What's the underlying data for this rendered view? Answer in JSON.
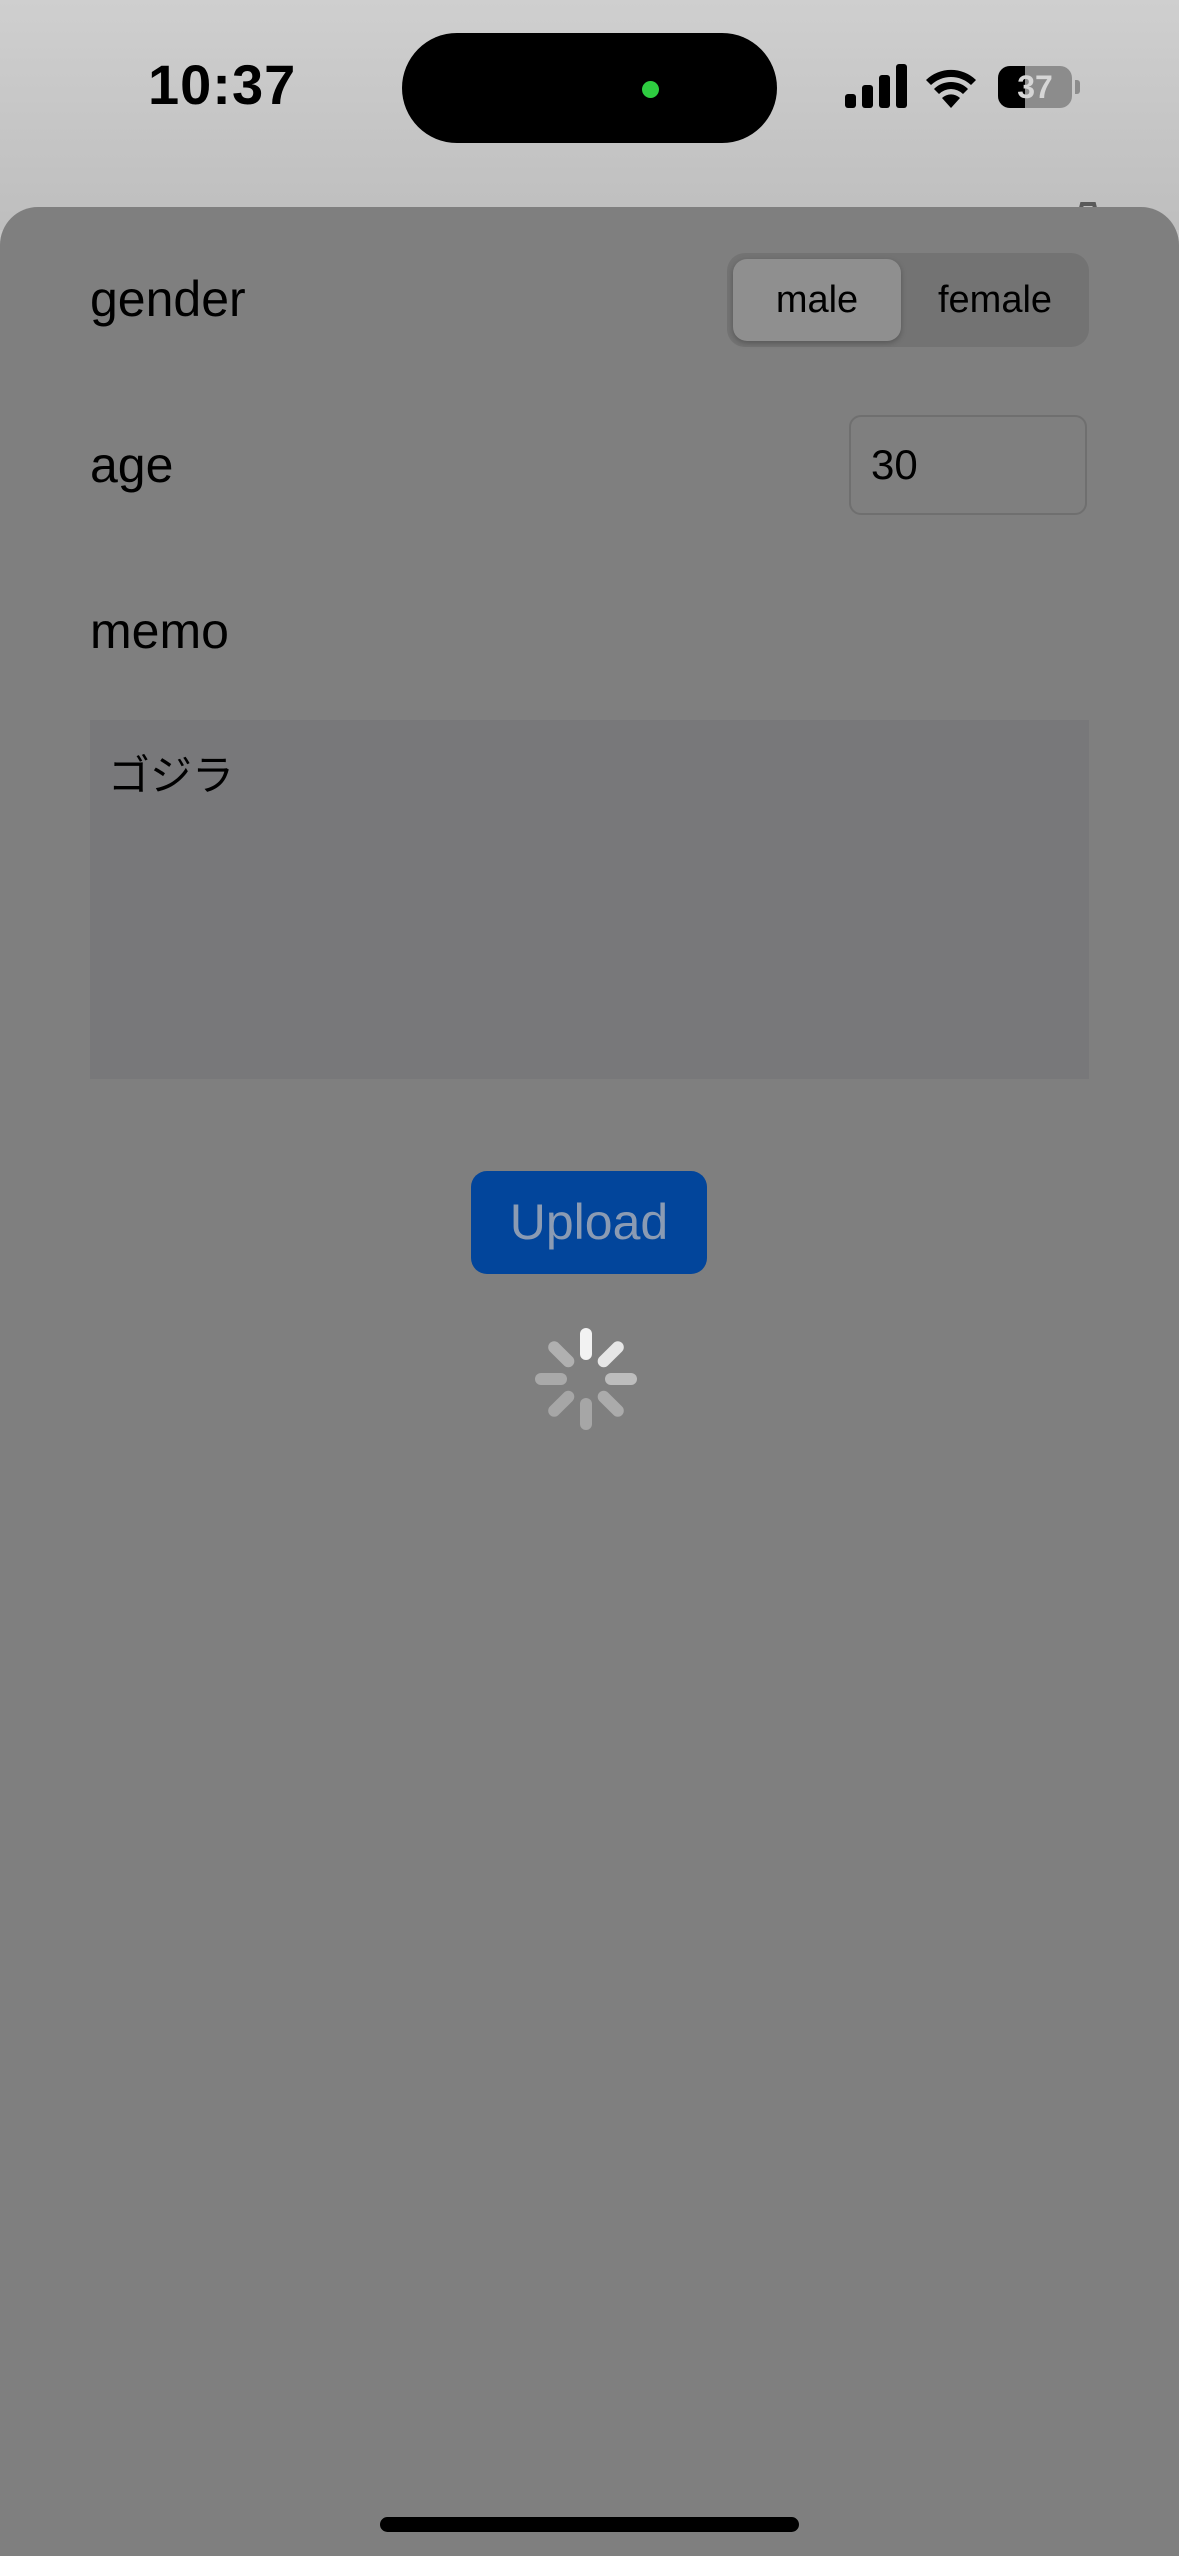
{
  "status_bar": {
    "time": "10:37",
    "battery_level": "37",
    "battery_fraction": 0.37
  },
  "form": {
    "gender": {
      "label": "gender",
      "options": [
        "male",
        "female"
      ],
      "selected": "male"
    },
    "age": {
      "label": "age",
      "value": "30"
    },
    "memo": {
      "label": "memo",
      "value": "ゴジラ"
    },
    "upload_label": "Upload"
  },
  "colors": {
    "accent": "#02459b",
    "overlay_gray": "#7f7f7f",
    "island_indicator": "#2ecc40"
  },
  "icons": {
    "signal": "cellular-signal-icon",
    "wifi": "wifi-icon",
    "battery": "battery-icon",
    "settings": "gear-icon",
    "loading": "activity-spinner-icon"
  }
}
